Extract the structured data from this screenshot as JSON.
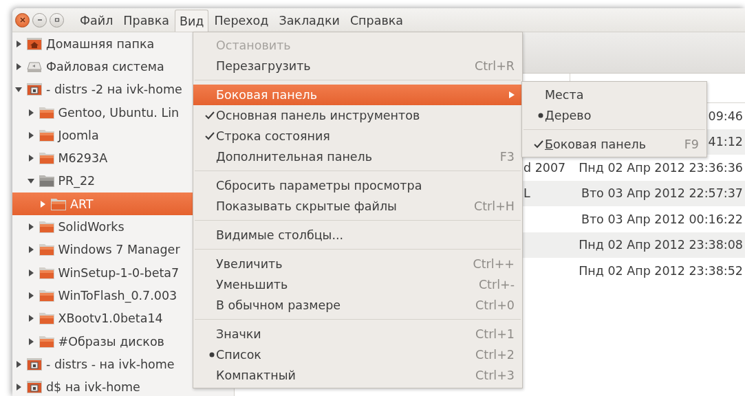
{
  "window_controls": [
    {
      "kind": "close"
    },
    {
      "kind": "minimize"
    },
    {
      "kind": "maximize"
    }
  ],
  "menubar": [
    {
      "label": "Файл",
      "selected": false
    },
    {
      "label": "Правка",
      "selected": false
    },
    {
      "label": "Вид",
      "selected": true
    },
    {
      "label": "Переход",
      "selected": false
    },
    {
      "label": "Закладки",
      "selected": false
    },
    {
      "label": "Справка",
      "selected": false
    }
  ],
  "sidebar": {
    "items": [
      {
        "label": "Домашняя папка",
        "kind": "home",
        "expanded": false,
        "selected": false
      },
      {
        "label": "Файловая система",
        "kind": "drive",
        "expanded": false,
        "selected": false
      },
      {
        "label": "- distrs -2 на ivk-home",
        "kind": "share",
        "expanded": true,
        "selected": false,
        "children": [
          {
            "label": "Gentoo, Ubuntu. Lin",
            "kind": "folder",
            "expanded": false,
            "selected": false
          },
          {
            "label": "Joomla",
            "kind": "folder",
            "expanded": false,
            "selected": false
          },
          {
            "label": "M6293A",
            "kind": "folder",
            "expanded": false,
            "selected": false
          },
          {
            "label": "PR_22",
            "kind": "gray",
            "expanded": true,
            "selected": false,
            "children": [
              {
                "label": "ART",
                "kind": "folder",
                "expanded": false,
                "selected": true
              }
            ]
          },
          {
            "label": "SolidWorks",
            "kind": "folder",
            "expanded": false,
            "selected": false
          },
          {
            "label": "Windows 7 Manager",
            "kind": "folder",
            "expanded": false,
            "selected": false
          },
          {
            "label": "WinSetup-1-0-beta7",
            "kind": "folder",
            "expanded": false,
            "selected": false
          },
          {
            "label": "WinToFlash_0.7.003",
            "kind": "folder",
            "expanded": false,
            "selected": false
          },
          {
            "label": "XBootv1.0beta14",
            "kind": "folder",
            "expanded": false,
            "selected": false
          },
          {
            "label": "#Образы дисков",
            "kind": "folder",
            "expanded": false,
            "selected": false
          }
        ]
      },
      {
        "label": "- distrs - на ivk-home",
        "kind": "share",
        "expanded": false,
        "selected": false
      },
      {
        "label": "d$ на ivk-home",
        "kind": "share",
        "expanded": false,
        "selected": false
      }
    ]
  },
  "table": {
    "rows": [
      {
        "date": "09:46"
      },
      {
        "date": "41:12"
      },
      {
        "name": "d 2007",
        "date": "Пнд 02 Апр 2012 23:36:36"
      },
      {
        "name": "L",
        "date": "Вто 03 Апр 2012 22:57:37"
      },
      {
        "date": "Вто 03 Апр 2012 00:16:22"
      },
      {
        "date": "Пнд 02 Апр 2012 23:38:08"
      },
      {
        "date": "Пнд 02 Апр 2012 23:38:52"
      }
    ]
  },
  "view_menu": {
    "groups": [
      [
        {
          "kind": "plain",
          "label": "Остановить",
          "disabled": true,
          "highlighted": false
        },
        {
          "kind": "plain",
          "label": "Перезагрузить",
          "shortcut": "Ctrl+R",
          "disabled": false,
          "highlighted": false
        }
      ],
      [
        {
          "kind": "submenu",
          "label": "Боковая панель",
          "disabled": false,
          "highlighted": true
        },
        {
          "kind": "check",
          "label": "Основная панель инструментов",
          "checked": true,
          "disabled": false,
          "highlighted": false
        },
        {
          "kind": "check",
          "label": "Строка состояния",
          "checked": true,
          "disabled": false,
          "highlighted": false
        },
        {
          "kind": "check",
          "label": "Дополнительная панель",
          "shortcut": "F3",
          "checked": false,
          "disabled": false,
          "highlighted": false
        }
      ],
      [
        {
          "kind": "plain",
          "label": "Сбросить параметры просмотра",
          "disabled": false,
          "highlighted": false
        },
        {
          "kind": "check",
          "label": "Показывать скрытые файлы",
          "shortcut": "Ctrl+H",
          "checked": false,
          "disabled": false,
          "highlighted": false
        }
      ],
      [
        {
          "kind": "plain",
          "label": "Видимые столбцы...",
          "disabled": false,
          "highlighted": false
        }
      ],
      [
        {
          "kind": "plain",
          "label": "Увеличить",
          "shortcut": "Ctrl++",
          "disabled": false,
          "highlighted": false
        },
        {
          "kind": "plain",
          "label": "Уменьшить",
          "shortcut": "Ctrl+-",
          "disabled": false,
          "highlighted": false
        },
        {
          "kind": "plain",
          "label": "В обычном размере",
          "shortcut": "Ctrl+0",
          "disabled": false,
          "highlighted": false
        }
      ],
      [
        {
          "kind": "radio",
          "label": "Значки",
          "shortcut": "Ctrl+1",
          "selected": false,
          "disabled": false,
          "highlighted": false
        },
        {
          "kind": "radio",
          "label": "Список",
          "shortcut": "Ctrl+2",
          "selected": true,
          "disabled": false,
          "highlighted": false
        },
        {
          "kind": "radio",
          "label": "Компактный",
          "shortcut": "Ctrl+3",
          "selected": false,
          "disabled": false,
          "highlighted": false
        }
      ]
    ]
  },
  "sidebar_submenu": {
    "groups": [
      [
        {
          "kind": "radio",
          "label": "Места",
          "selected": false,
          "underlined_mnemonic": false
        },
        {
          "kind": "radio",
          "label": "Дерево",
          "selected": true,
          "underlined_mnemonic": false
        }
      ],
      [
        {
          "kind": "check",
          "label": "Боковая панель",
          "shortcut": "F9",
          "checked": true,
          "underlined_mnemonic": true
        }
      ]
    ]
  }
}
